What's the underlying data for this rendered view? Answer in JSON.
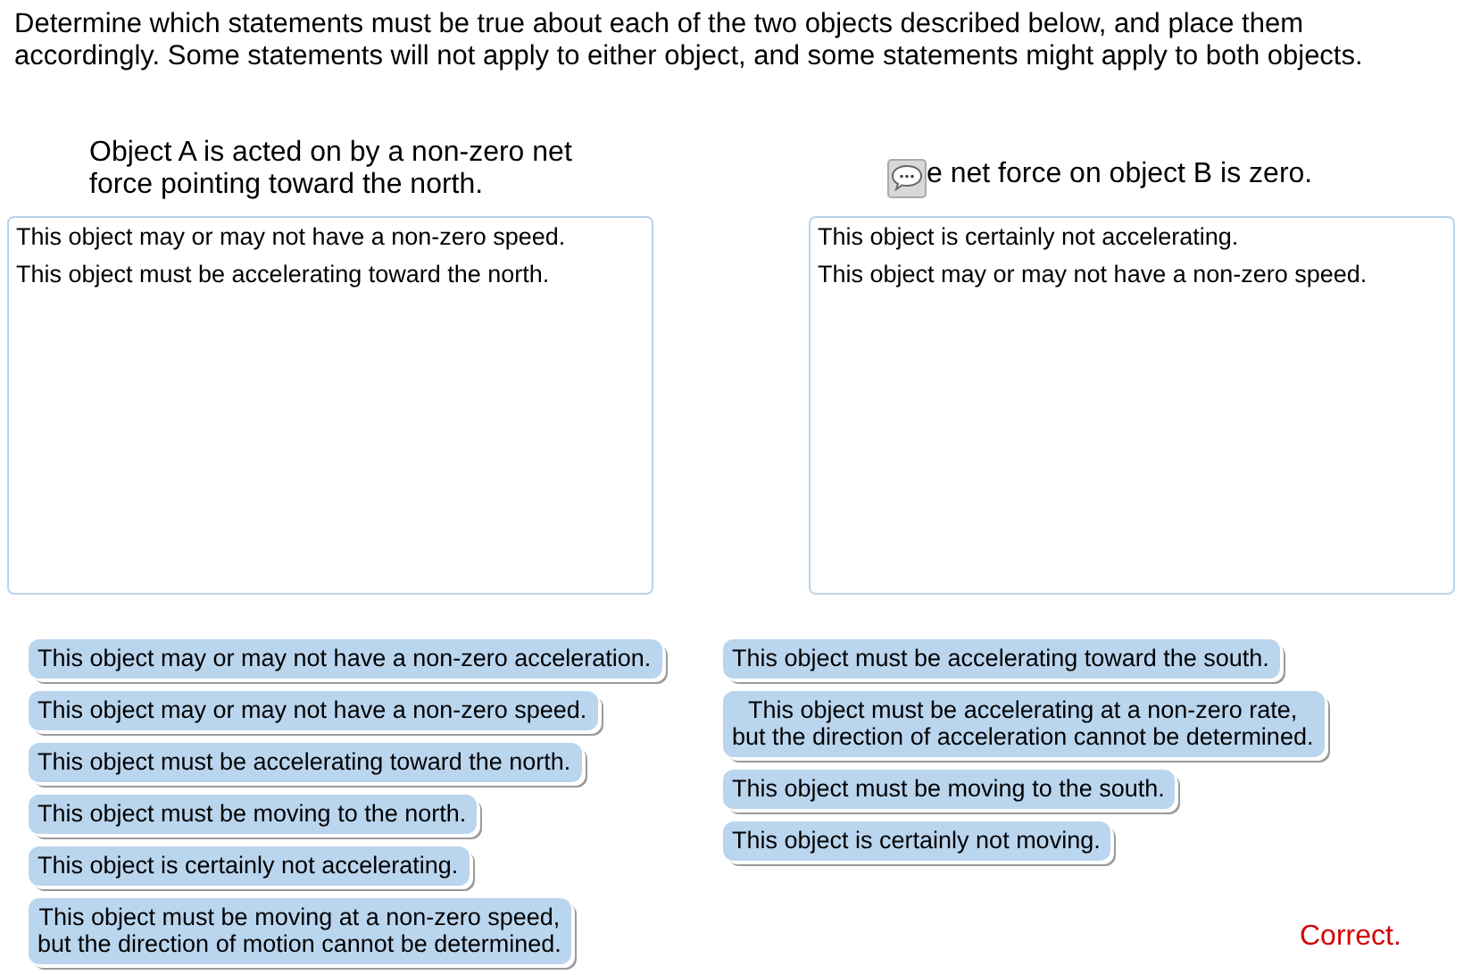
{
  "instructions": "Determine which statements must be true about each of the two objects described below, and place them accordingly. Some statements will not apply to either object, and some statements might apply to both objects.",
  "targets": [
    {
      "heading": "Object A is acted on by a non-zero net force pointing toward the north.",
      "comment_icon": false,
      "placed": [
        "This object may or may not have a non-zero speed.",
        "This object must be accelerating toward the north."
      ]
    },
    {
      "heading": "e net force on object B is zero.",
      "comment_icon": true,
      "placed": [
        "This object is certainly not accelerating.",
        "This object may or may not have a non-zero speed."
      ]
    }
  ],
  "bank": [
    [
      "This object may or may not have a non-zero acceleration.",
      "This object may or may not have a non-zero speed.",
      "This object must be accelerating toward the north.",
      "This object must be moving to the north.",
      "This object is certainly not accelerating.",
      "This object must be moving at a non-zero speed,\nbut the direction of motion cannot be determined."
    ],
    [
      "This object must be accelerating toward the south.",
      "This object must be accelerating at a non-zero rate,\nbut the direction of acceleration cannot be determined.",
      "This object must be moving to the south.",
      "This object is certainly not moving."
    ]
  ],
  "feedback": "Correct."
}
